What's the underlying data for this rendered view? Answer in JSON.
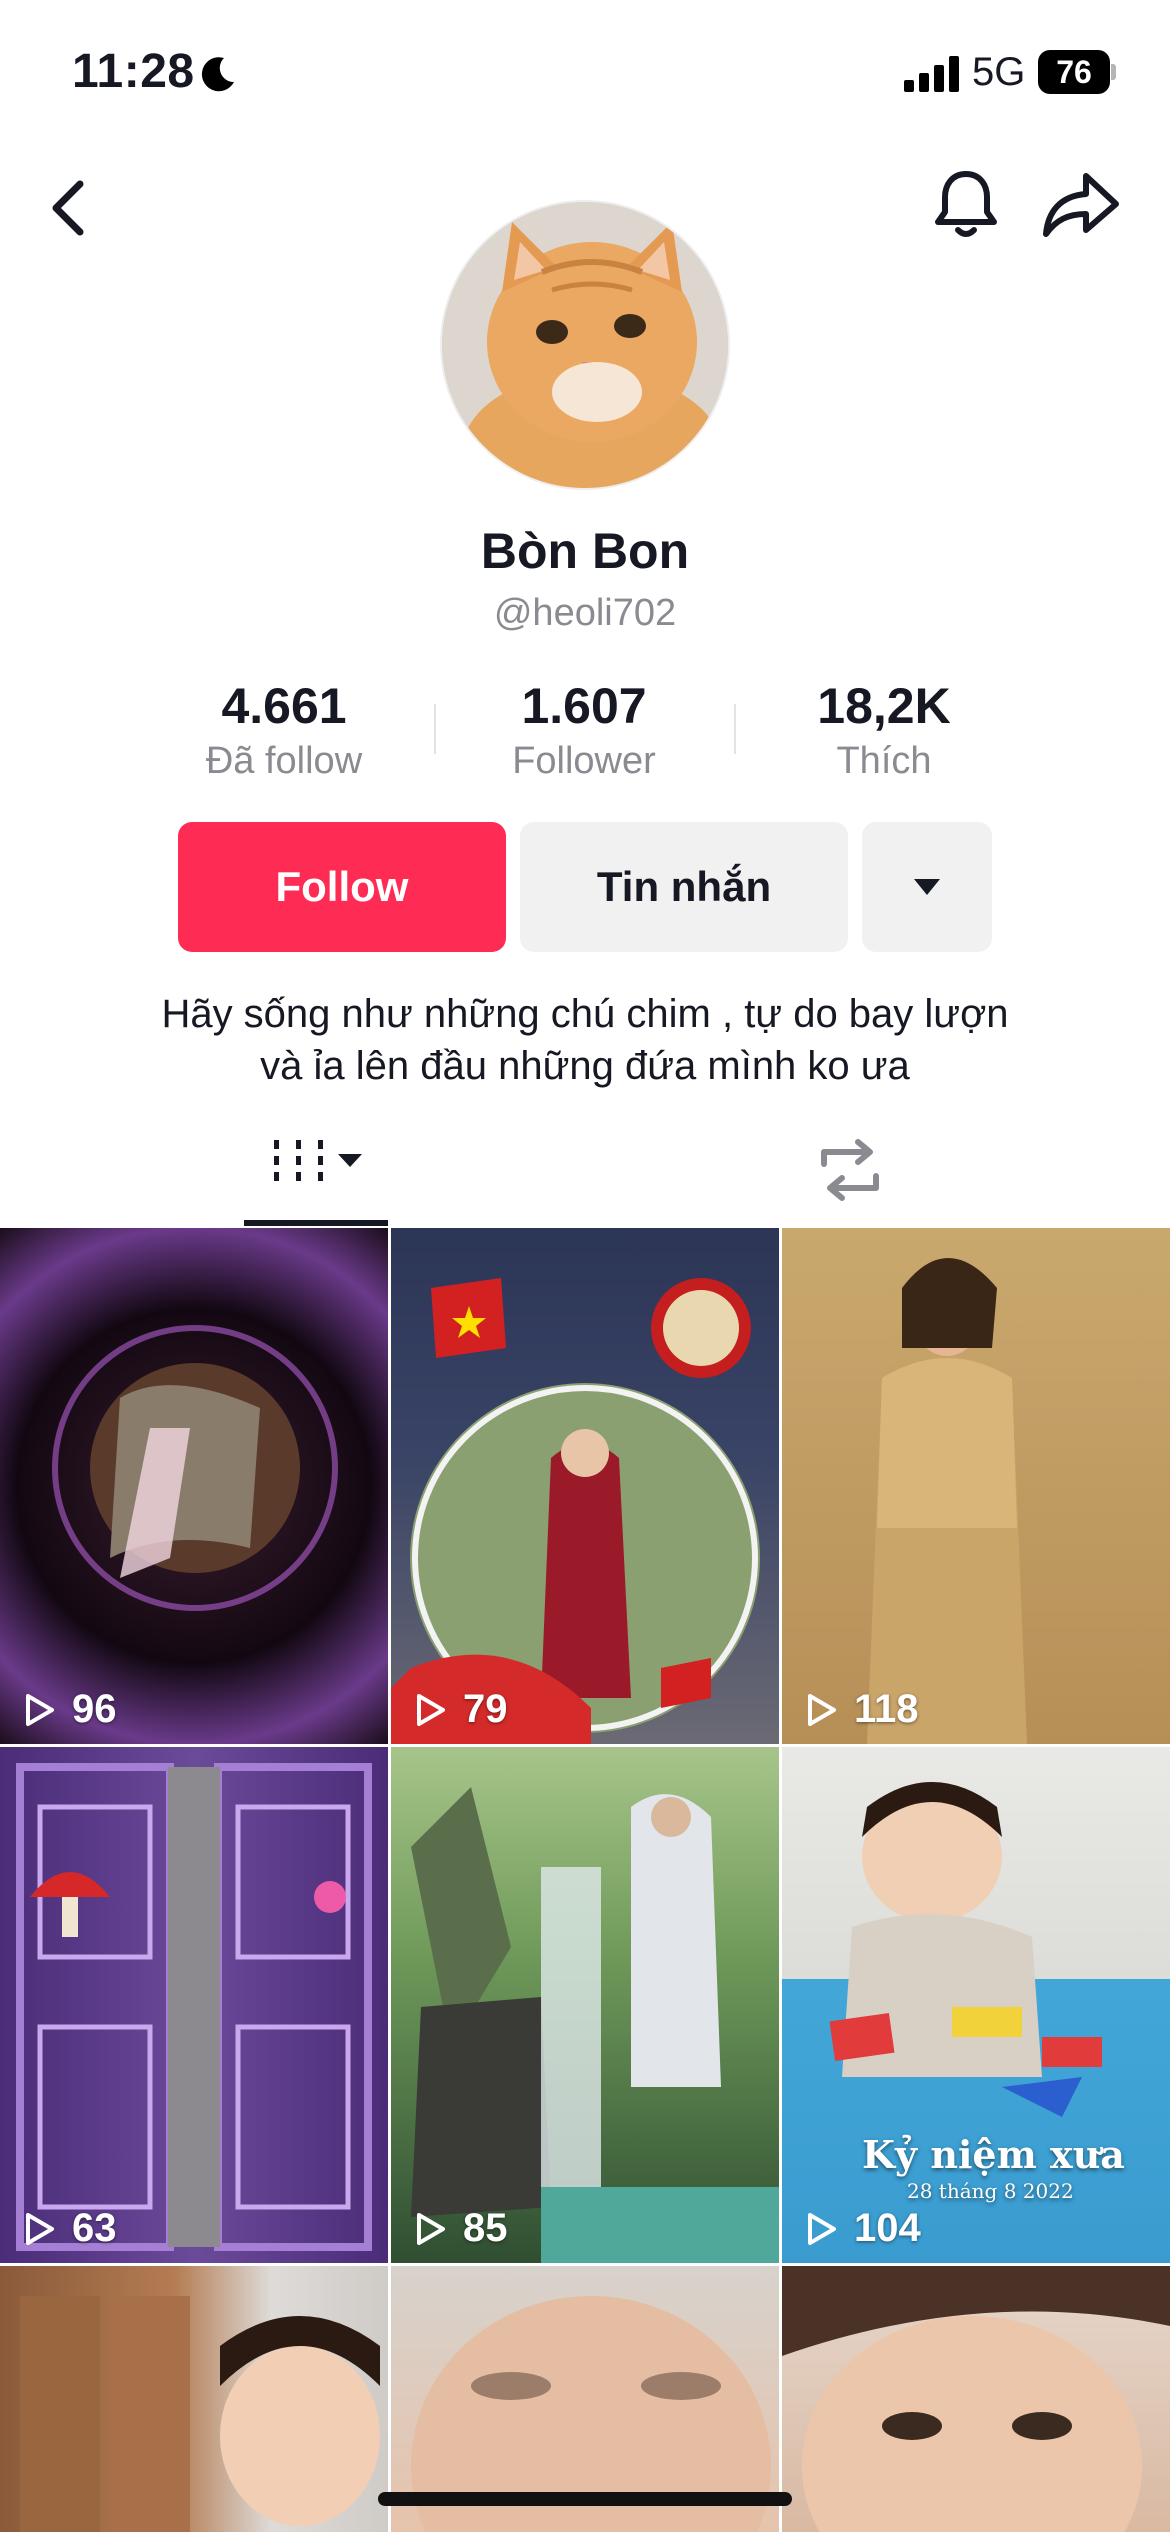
{
  "status_bar": {
    "time": "11:28",
    "network": "5G",
    "battery": "76"
  },
  "profile": {
    "display_name": "Bòn Bon",
    "handle": "@heoli702",
    "bio_line1": "Hãy sống như những chú chim , tự do bay lượn",
    "bio_line2": "và ỉa lên đầu những đứa mình ko ưa"
  },
  "stats": [
    {
      "value": "4.661",
      "label": "Đã follow"
    },
    {
      "value": "1.607",
      "label": "Follower"
    },
    {
      "value": "18,2K",
      "label": "Thích"
    }
  ],
  "actions": {
    "follow_label": "Follow",
    "message_label": "Tin nhắn"
  },
  "videos": [
    {
      "views": "96"
    },
    {
      "views": "79"
    },
    {
      "views": "118"
    },
    {
      "views": "63"
    },
    {
      "views": "85"
    },
    {
      "views": "104",
      "caption": "Kỷ niệm xưa",
      "caption_date": "28 tháng 8 2022"
    },
    {},
    {},
    {}
  ],
  "icons": {
    "back": "chevron-left-icon",
    "bell": "bell-icon",
    "share": "share-arrow-icon",
    "videos_tab": "grid-icon",
    "reposts_tab": "repost-icon",
    "play": "play-outline-icon"
  },
  "colors": {
    "accent": "#fe2c55",
    "secondary_button": "#f1f1f2",
    "muted_text": "#8a8b91"
  }
}
